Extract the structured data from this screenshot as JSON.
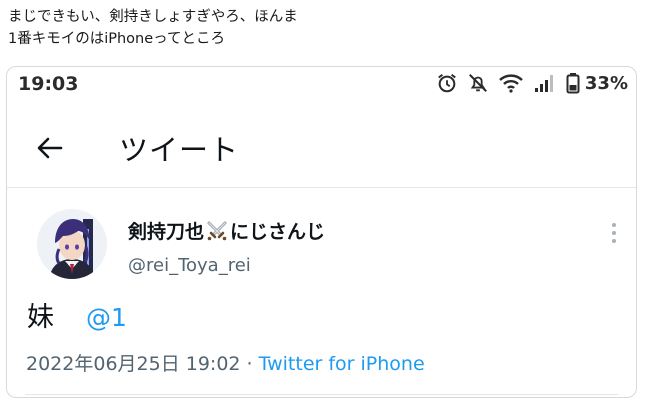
{
  "caption": {
    "line1": "まじできもい、剣持きしょすぎやろ、ほんま",
    "line2": "1番キモイのはiPhoneってところ"
  },
  "status_bar": {
    "time": "19:03",
    "battery_percent": "33%",
    "icons": [
      "alarm-icon",
      "mute-icon",
      "wifi-icon",
      "signal-icon",
      "battery-icon"
    ]
  },
  "header": {
    "title": "ツイート",
    "back_icon": "arrow-left-icon"
  },
  "tweet": {
    "display_name": "剣持刀也",
    "name_suffix": "にじさんじ",
    "name_emoji_icon": "crossed-swords-icon",
    "handle": "@rei_Toya_rei",
    "text": "妹",
    "mention": "@1",
    "timestamp": "2022年06月25日 19:02",
    "separator": " · ",
    "source": "Twitter for iPhone"
  },
  "colors": {
    "link": "#1d9bf0",
    "secondary_text": "#536471",
    "primary_text": "#0f1419"
  }
}
